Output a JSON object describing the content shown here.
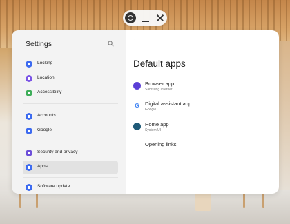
{
  "window_controls": {
    "app_icon": "app-icon",
    "minimize_icon": "minimize-icon",
    "close_icon": "close-icon"
  },
  "sidebar": {
    "title": "Settings",
    "search_icon": "search-icon",
    "groups": [
      [
        {
          "label": "Locking",
          "icon": "lock-icon",
          "color": "#3d6bf0"
        },
        {
          "label": "Location",
          "icon": "location-pin-icon",
          "color": "#7b54e6"
        },
        {
          "label": "Accessibility",
          "icon": "accessibility-icon",
          "color": "#3fae5a"
        }
      ],
      [
        {
          "label": "Accounts",
          "icon": "accounts-icon",
          "color": "#3d6bf0"
        },
        {
          "label": "Google",
          "icon": "google-icon",
          "color": "#3d6bf0"
        }
      ],
      [
        {
          "label": "Security and privacy",
          "icon": "shield-icon",
          "color": "#6d4fd9"
        },
        {
          "label": "Apps",
          "icon": "apps-grid-icon",
          "color": "#3d6bf0",
          "selected": true
        }
      ],
      [
        {
          "label": "Software update",
          "icon": "software-update-icon",
          "color": "#3d6bf0"
        }
      ]
    ]
  },
  "main": {
    "back_icon": "back-arrow-icon",
    "title": "Default apps",
    "apps": [
      {
        "title": "Browser app",
        "subtitle": "Samsung Internet",
        "icon": "browser-icon",
        "color": "#5b3fd6"
      },
      {
        "title": "Digital assistant app",
        "subtitle": "Google",
        "icon": "google-g-icon",
        "color": "#ffffff"
      },
      {
        "title": "Home app",
        "subtitle": "System UI",
        "icon": "home-app-icon",
        "color": "#1f5a78"
      },
      {
        "title": "Opening links",
        "subtitle": "",
        "icon": "",
        "color": ""
      }
    ]
  }
}
